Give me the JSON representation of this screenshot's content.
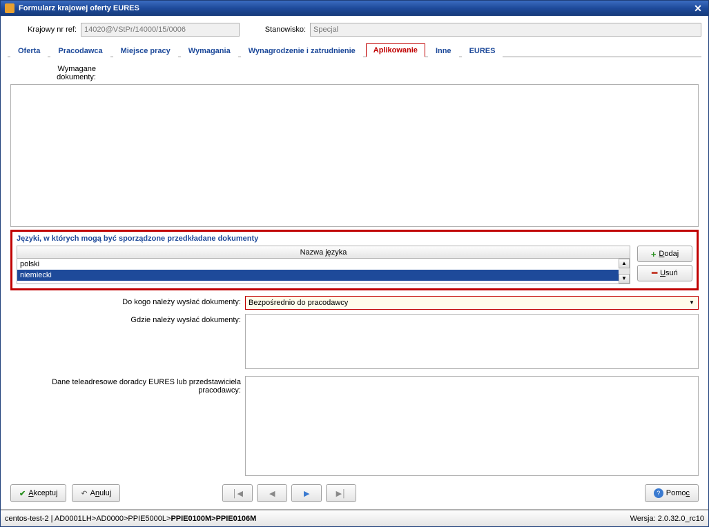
{
  "window": {
    "title": "Formularz krajowej oferty EURES"
  },
  "header": {
    "ref_label": "Krajowy nr ref:",
    "ref_value": "14020@VStPr/14000/15/0006",
    "stan_label": "Stanowisko:",
    "stan_value": "Specjal"
  },
  "tabs": [
    "Oferta",
    "Pracodawca",
    "Miejsce pracy",
    "Wymagania",
    "Wynagrodzenie i zatrudnienie",
    "Aplikowanie",
    "Inne",
    "EURES"
  ],
  "active_tab": "Aplikowanie",
  "docs_label": "Wymagane dokumenty:",
  "lang_section": {
    "title": "Języki, w których mogą być sporządzone przedkładane dokumenty",
    "column": "Nazwa języka",
    "rows": [
      "polski",
      "niemiecki"
    ],
    "selected_index": 1,
    "add_label": "Dodaj",
    "del_label": "Usuń"
  },
  "send_to": {
    "label": "Do kogo należy wysłać dokumenty:",
    "value": "Bezpośrednio do pracodawcy"
  },
  "send_where_label": "Gdzie należy wysłać dokumenty:",
  "advisor_label": "Dane teleadresowe doradcy EURES lub przedstawiciela pracodawcy:",
  "buttons": {
    "accept": "Akceptuj",
    "cancel": "Anuluj",
    "help": "Pomoc"
  },
  "statusbar": {
    "host": "centos-test-2",
    "path_plain": " | AD0001LH>AD0000>PPIE5000L>",
    "path_bold": "PPIE0100M>PPIE0106M",
    "version_label": "Wersja: ",
    "version": "2.0.32.0_rc10"
  }
}
